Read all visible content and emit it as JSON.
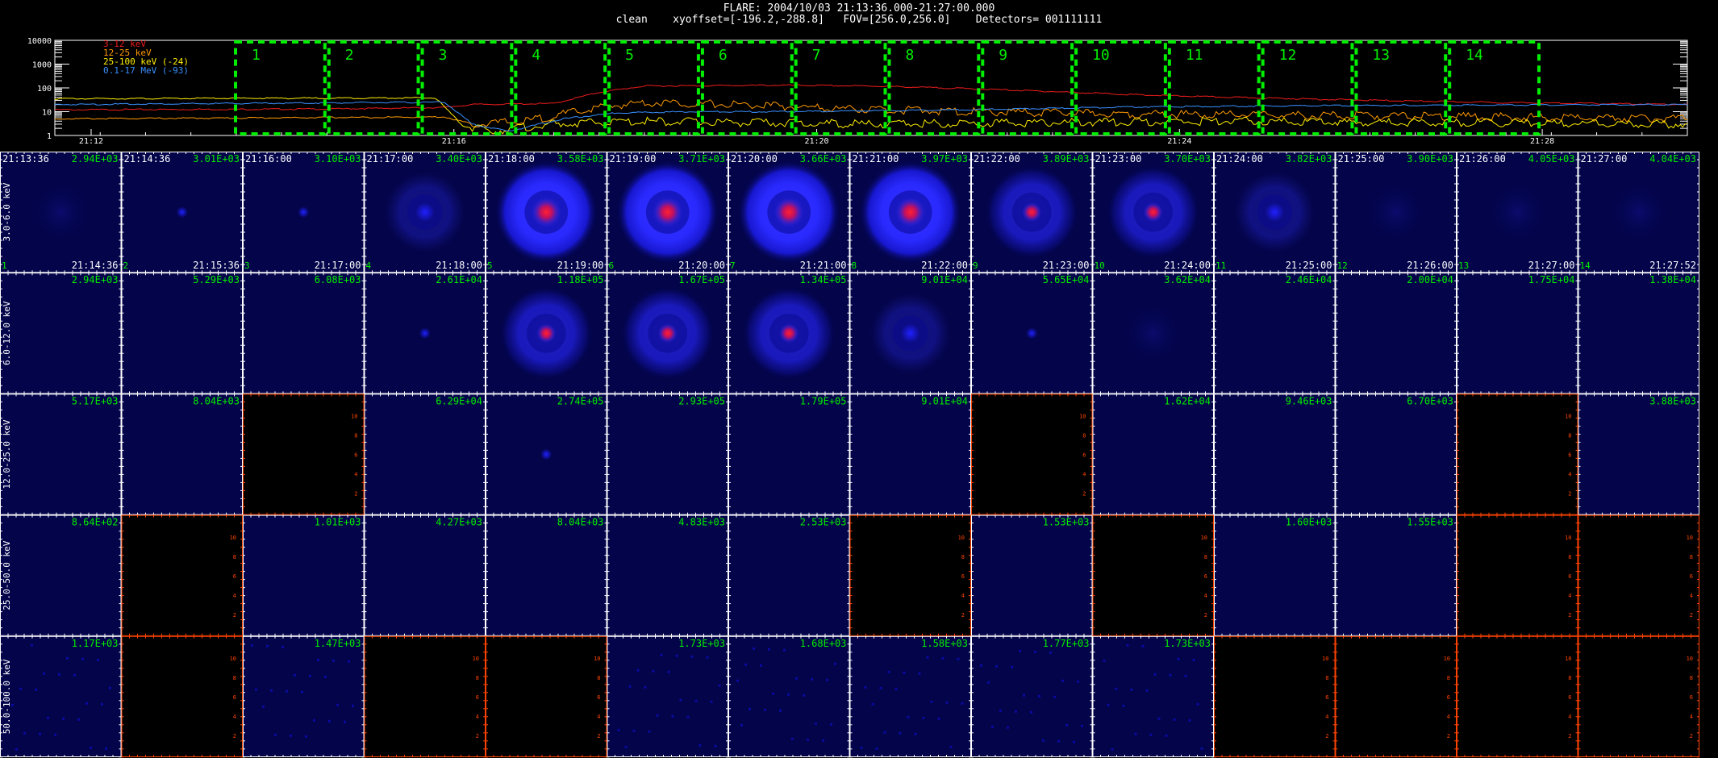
{
  "header": {
    "line1": "FLARE: 2004/10/03 21:13:36.000-21:27:00.000",
    "line2": "clean    xyoffset=[-196.2,-288.8]   FOV=[256.0,256.0]    Detectors= 001111111"
  },
  "colors": {
    "grid_green": "#00ee00",
    "frame_white": "#ffffff",
    "empty_frame": "#ff4400",
    "panel_bg": "#03044a"
  },
  "chart_data": [
    {
      "type": "line",
      "scale": "log",
      "ylim": [
        1,
        10000
      ],
      "yticks": [
        "10000",
        "1000",
        "100",
        "10",
        "1"
      ],
      "xlim_minutes": [
        0,
        18
      ],
      "xticks": [
        {
          "label": "21:12",
          "minute": 0.4
        },
        {
          "label": "21:16",
          "minute": 4.4
        },
        {
          "label": "21:20",
          "minute": 8.4
        },
        {
          "label": "21:24",
          "minute": 12.4
        },
        {
          "label": "21:28",
          "minute": 16.4
        }
      ],
      "series": [
        {
          "name": "3-12 keV",
          "color": "#ee1c1c",
          "points": [
            [
              0,
              12
            ],
            [
              3,
              13
            ],
            [
              4.3,
              15
            ],
            [
              4.6,
              20
            ],
            [
              5.5,
              22
            ],
            [
              6,
              65
            ],
            [
              6.5,
              120
            ],
            [
              8,
              130
            ],
            [
              9,
              120
            ],
            [
              10,
              95
            ],
            [
              11,
              70
            ],
            [
              12,
              50
            ],
            [
              13,
              40
            ],
            [
              14,
              33
            ],
            [
              15,
              28
            ],
            [
              16,
              24
            ],
            [
              17,
              22
            ],
            [
              18,
              20
            ]
          ]
        },
        {
          "name": "12-25 keV",
          "color": "#ff9a00",
          "points": [
            [
              0,
              5
            ],
            [
              4.3,
              6
            ],
            [
              4.6,
              3
            ],
            [
              5.2,
              4
            ],
            [
              6,
              15
            ],
            [
              6.5,
              25
            ],
            [
              7.5,
              20
            ],
            [
              8.5,
              14
            ],
            [
              10,
              10
            ],
            [
              12,
              8
            ],
            [
              14,
              7
            ],
            [
              16,
              6
            ],
            [
              18,
              5
            ]
          ]
        },
        {
          "name": "25-100 keV (-24)",
          "color": "#ffee00",
          "points": [
            [
              0,
              35
            ],
            [
              4.2,
              38
            ],
            [
              4.5,
              2.5
            ],
            [
              4.8,
              1.5
            ],
            [
              5.5,
              3
            ],
            [
              6.5,
              4
            ],
            [
              7.5,
              3.5
            ],
            [
              9,
              3
            ],
            [
              11,
              3.5
            ],
            [
              13,
              4
            ],
            [
              15,
              3.5
            ],
            [
              18,
              3
            ]
          ]
        },
        {
          "name": "0.1-17 MeV (-93)",
          "color": "#3a90ff",
          "points": [
            [
              0,
              20
            ],
            [
              4.3,
              25
            ],
            [
              4.6,
              3
            ],
            [
              5,
              1.5
            ],
            [
              5.6,
              5
            ],
            [
              6.2,
              9
            ],
            [
              7,
              10
            ],
            [
              8,
              10
            ],
            [
              10,
              12
            ],
            [
              12,
              16
            ],
            [
              14,
              18
            ],
            [
              16,
              19
            ],
            [
              18,
              20
            ]
          ]
        }
      ],
      "intervals": [
        "1",
        "2",
        "3",
        "4",
        "5",
        "6",
        "7",
        "8",
        "9",
        "10",
        "11",
        "12",
        "13",
        "14"
      ]
    },
    {
      "type": "heatmap",
      "rows": [
        "3.0-6.0 keV",
        "6.0-12.0 keV",
        "12.0-25.0 keV",
        "25.0-50.0 keV",
        "50.0-100.0 keV"
      ],
      "start_times": [
        "21:13:36",
        "21:14:36",
        "21:16:00",
        "21:17:00",
        "21:18:00",
        "21:19:00",
        "21:20:00",
        "21:21:00",
        "21:22:00",
        "21:23:00",
        "21:24:00",
        "21:25:00",
        "21:26:00",
        "21:27:00"
      ],
      "end_times": [
        "21:14:36",
        "21:15:36",
        "21:17:00",
        "21:18:00",
        "21:19:00",
        "21:20:00",
        "21:21:00",
        "21:22:00",
        "21:23:00",
        "21:24:00",
        "21:25:00",
        "21:26:00",
        "21:27:00",
        "21:27:52"
      ],
      "peaks": [
        [
          "2.94E+03",
          "3.01E+03",
          "3.10E+03",
          "3.40E+03",
          "3.58E+03",
          "3.71E+03",
          "3.66E+03",
          "3.97E+03",
          "3.89E+03",
          "3.70E+03",
          "3.82E+03",
          "3.90E+03",
          "4.05E+03",
          "4.04E+03"
        ],
        [
          "2.94E+03",
          "5.29E+03",
          "6.08E+03",
          "2.61E+04",
          "1.18E+05",
          "1.67E+05",
          "1.34E+05",
          "9.01E+04",
          "5.65E+04",
          "3.62E+04",
          "2.46E+04",
          "2.00E+04",
          "1.75E+04",
          "1.38E+04"
        ],
        [
          "5.17E+03",
          "8.04E+03",
          "",
          "6.29E+04",
          "2.74E+05",
          "2.93E+05",
          "1.79E+05",
          "9.01E+04",
          "",
          "1.62E+04",
          "9.46E+03",
          "6.70E+03",
          "",
          "3.88E+03"
        ],
        [
          "8.64E+02",
          "",
          "1.01E+03",
          "4.27E+03",
          "8.04E+03",
          "4.83E+03",
          "2.53E+03",
          "",
          "1.53E+03",
          "",
          "1.60E+03",
          "1.55E+03",
          "",
          ""
        ],
        [
          "1.17E+03",
          "",
          "1.47E+03",
          "",
          "",
          "1.73E+03",
          "1.68E+03",
          "1.58E+03",
          "1.77E+03",
          "1.73E+03",
          "",
          "",
          "",
          ""
        ]
      ],
      "blob_type": [
        [
          "faint",
          "dot",
          "dot",
          "ring1",
          "ring3",
          "ring3",
          "ring3",
          "ring3",
          "ring2",
          "ring2",
          "ring1",
          "faint",
          "faint",
          "faint"
        ],
        [
          "none",
          "none",
          "none",
          "dot",
          "ring2",
          "ring2",
          "ring2",
          "ring1",
          "dot",
          "faint",
          "none",
          "none",
          "none",
          "none"
        ],
        [
          "none",
          "none",
          "empty",
          "none",
          "dot",
          "none",
          "none",
          "none",
          "empty",
          "none",
          "none",
          "none",
          "empty",
          "none"
        ],
        [
          "none",
          "empty",
          "none",
          "none",
          "none",
          "none",
          "none",
          "empty",
          "none",
          "empty",
          "none",
          "none",
          "empty",
          "empty"
        ],
        [
          "noise",
          "empty",
          "noise",
          "empty",
          "empty",
          "noise",
          "noise",
          "noise",
          "noise",
          "noise",
          "empty",
          "empty",
          "empty",
          "empty"
        ]
      ]
    }
  ]
}
